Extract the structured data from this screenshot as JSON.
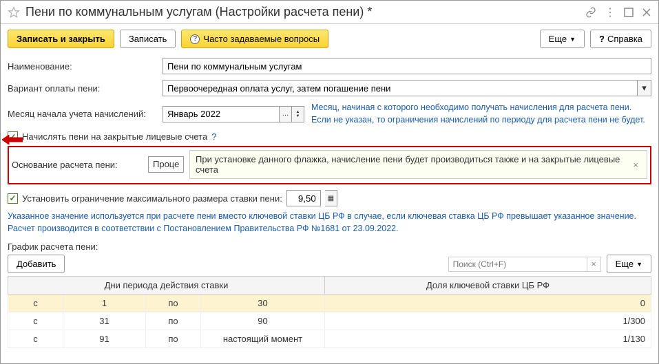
{
  "header": {
    "title": "Пени по коммунальным услугам (Настройки расчета пени) *"
  },
  "toolbar": {
    "save_close": "Записать и закрыть",
    "save": "Записать",
    "faq": "Часто задаваемые вопросы",
    "more": "Еще",
    "help": "Справка"
  },
  "fields": {
    "name_label": "Наименование:",
    "name_value": "Пени по коммунальным услугам",
    "variant_label": "Вариант оплаты пени:",
    "variant_value": "Первоочередная оплата услуг, затем погашение пени",
    "month_label": "Месяц начала учета начислений:",
    "month_value": "Январь 2022",
    "month_info": "Месяц, начиная с которого необходимо получать начисления для расчета пени. Если не указан, то ограничения начислений по периоду для расчета пени не будет.",
    "closed_accounts": "Начислять пени на закрытые лицевые счета",
    "basis_label": "Основание расчета пени:",
    "basis_partial": "Проце",
    "tooltip": "При установке данного флажка, начисление пени будет производиться также и на закрытые лицевые счета",
    "rate_label": "Установить ограничение максимального размера ставки пени:",
    "rate_value": "9,50",
    "rate_info": "Указанное значение используется при расчете пени вместо ключевой ставки ЦБ РФ в случае, если ключевая ставка ЦБ РФ превышает указанное значение. Расчет производится в соответствии с Постановлением Правительства РФ №1681 от 23.09.2022.",
    "schedule_label": "График расчета пени:",
    "add": "Добавить",
    "search_placeholder": "Поиск (Ctrl+F)",
    "more2": "Еще"
  },
  "table": {
    "header1": "Дни периода действия ставки",
    "header2": "Доля ключевой ставки ЦБ РФ",
    "rows": [
      {
        "from_lbl": "с",
        "from": "1",
        "to_lbl": "по",
        "to": "30",
        "rate": "0"
      },
      {
        "from_lbl": "с",
        "from": "31",
        "to_lbl": "по",
        "to": "90",
        "rate": "1/300"
      },
      {
        "from_lbl": "с",
        "from": "91",
        "to_lbl": "по",
        "to": "настоящий момент",
        "rate": "1/130"
      }
    ]
  }
}
